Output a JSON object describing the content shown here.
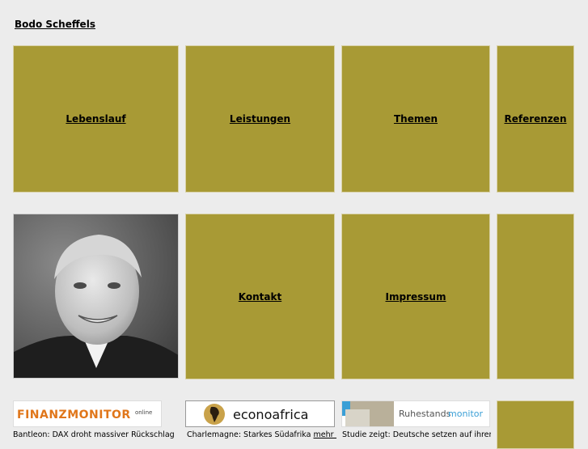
{
  "header": {
    "title": "Bodo Scheffels"
  },
  "tiles": {
    "lebenslauf": "Lebenslauf",
    "leistungen": "Leistungen",
    "themen": "Themen",
    "referenzen": "Referenzen",
    "kontakt": "Kontakt",
    "impressum": "Impressum"
  },
  "news": [
    {
      "logo_text": "FINANZMONITOR",
      "logo_suffix": "online",
      "headline": "Bantleon: DAX droht massiver Rückschlag"
    },
    {
      "logo_text": "econoafrica",
      "headline": "Charlemagne: Starkes Südafrika",
      "more": "mehr ..."
    },
    {
      "logo_text_a": "Ruhestands",
      "logo_text_b": "monitor",
      "headline": "Studie zeigt: Deutsche setzen auf ihren"
    }
  ],
  "colors": {
    "tile": "#a89a35",
    "background": "#ececec",
    "finanz_orange": "#e0761a",
    "ruhestand_blue": "#3a9fd6"
  }
}
